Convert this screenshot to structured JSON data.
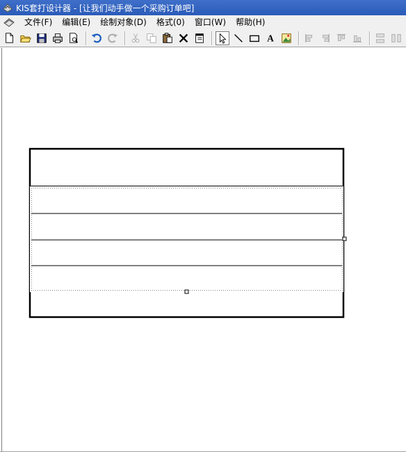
{
  "window": {
    "title": "KIS套打设计器 - [让我们动手做一个采购订单吧]",
    "app_icon": "kis-app-icon"
  },
  "menu": {
    "doc_icon": "document-icon",
    "items": [
      "文件(F)",
      "编辑(E)",
      "绘制对象(D)",
      "格式(0)",
      "窗口(W)",
      "帮助(H)"
    ]
  },
  "toolbar": {
    "buttons": [
      {
        "name": "new-icon"
      },
      {
        "name": "open-icon"
      },
      {
        "name": "save-icon"
      },
      {
        "name": "print-icon"
      },
      {
        "name": "print-preview-icon"
      },
      {
        "sep": true
      },
      {
        "name": "undo-icon"
      },
      {
        "name": "redo-icon"
      },
      {
        "sep": true
      },
      {
        "name": "cut-icon"
      },
      {
        "name": "copy-icon"
      },
      {
        "name": "paste-icon"
      },
      {
        "name": "delete-icon"
      },
      {
        "name": "properties-icon"
      },
      {
        "sep": true
      },
      {
        "name": "select-pointer-icon",
        "pressed": true
      },
      {
        "name": "line-icon"
      },
      {
        "name": "rectangle-icon"
      },
      {
        "name": "text-icon"
      },
      {
        "name": "image-icon"
      },
      {
        "sep": true
      },
      {
        "name": "align-left-icon"
      },
      {
        "name": "align-right-icon"
      },
      {
        "name": "align-top-icon"
      },
      {
        "name": "align-bottom-icon"
      },
      {
        "sep": true
      },
      {
        "name": "same-height-icon"
      },
      {
        "name": "same-width-icon"
      }
    ]
  },
  "design": {
    "table_rows": 6,
    "selected_rows": [
      2,
      3,
      4,
      5
    ]
  },
  "colors": {
    "titlebar": "#2a5bb8",
    "chrome": "#f0f0f0",
    "accent_blue": "#1f5fbf"
  }
}
